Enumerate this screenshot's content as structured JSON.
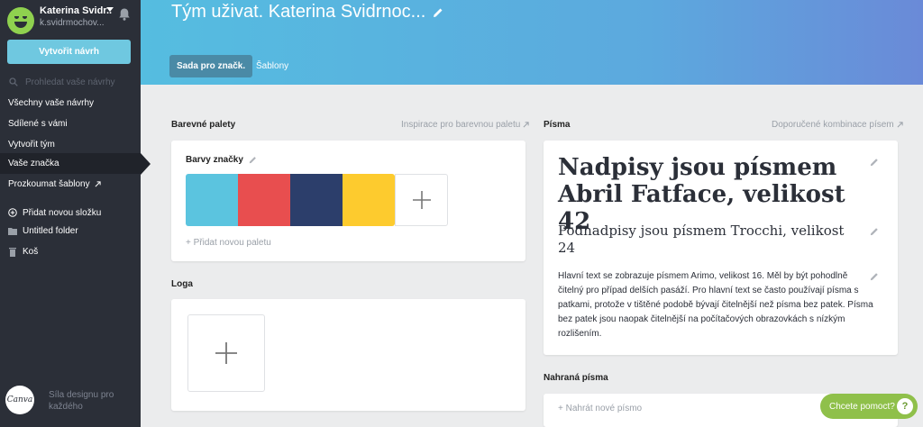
{
  "sidebar": {
    "profile_name": "Katerina Svidr...",
    "profile_email": "k.svidrmochov...",
    "create_label": "Vytvořit návrh",
    "search_placeholder": "Prohledat vaše návrhy",
    "nav": [
      {
        "label": "Všechny vaše návrhy"
      },
      {
        "label": "Sdílené s vámi"
      },
      {
        "label": "Vytvořit tým"
      },
      {
        "label": "Vaše značka"
      },
      {
        "label": "Prozkoumat šablony"
      }
    ],
    "add_folder": "Přidat novou složku",
    "folder": "Untitled folder",
    "trash": "Koš",
    "logo_text": "Canva",
    "footer_text": "Síla designu pro každého"
  },
  "header": {
    "title": "Tým uživat. Katerina Svidrnoc...",
    "tabs": [
      {
        "label": "Sada pro značk."
      },
      {
        "label": "Šablony"
      }
    ]
  },
  "palettes": {
    "title": "Barevné palety",
    "link": "Inspirace pro barevnou paletu",
    "palette_name": "Barvy značky",
    "colors": [
      "#5bc4df",
      "#e84e4f",
      "#2c3e6b",
      "#fdcb2e"
    ],
    "add_label": "+ Přidat novou paletu"
  },
  "logos": {
    "title": "Loga"
  },
  "fonts": {
    "title": "Písma",
    "link": "Doporučené kombinace písem",
    "heading": "Nadpisy jsou písmem Abril Fatface, velikost 42",
    "subheading": "Podnadpisy jsou písmem Trocchi, velikost 24",
    "body": "Hlavní text se zobrazuje písmem Arimo, velikost 16. Měl by být pohodlně čitelný pro případ delších pasáží. Pro hlavní text se často používají písma s patkami, protože v tištěné podobě bývají čitelnější než písma bez patek. Písma bez patek jsou naopak čitelnější na počítačových obrazovkách s nízkým rozlišením."
  },
  "uploaded": {
    "title": "Nahraná písma",
    "upload_label": "+ Nahrát nové písmo"
  },
  "help": {
    "label": "Chcete pomoct?",
    "q": "?"
  }
}
